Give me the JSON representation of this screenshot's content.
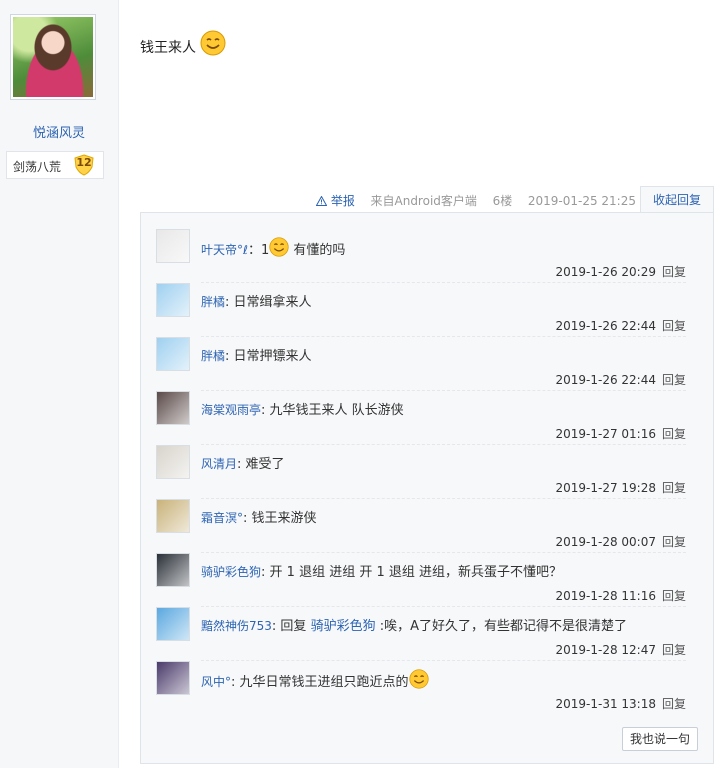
{
  "author": {
    "username": "悦涵风灵",
    "level_name": "剑荡八荒",
    "level_number": "12"
  },
  "post": {
    "content": "钱王来人",
    "report_label": "举报",
    "client": "来自Android客户端",
    "floor": "6楼",
    "time": "2019-01-25 21:25",
    "collapse_label": "收起回复"
  },
  "replies": [
    {
      "user": "叶天帝°ℓ",
      "sep": "：1",
      "text": "有懂的吗",
      "quoted": "",
      "time": "2019-1-26 20:29",
      "reply_label": "回复",
      "avatar_color": "#e8e8e8"
    },
    {
      "user": "胖橘",
      "sep": ": ",
      "text": "日常缉拿来人",
      "quoted": "",
      "time": "2019-1-26 22:44",
      "reply_label": "回复",
      "avatar_color": "#9fd0f0"
    },
    {
      "user": "胖橘",
      "sep": ": ",
      "text": "日常押镖来人",
      "quoted": "",
      "time": "2019-1-26 22:44",
      "reply_label": "回复",
      "avatar_color": "#9fd0f0"
    },
    {
      "user": "海棠观雨亭",
      "sep": ": ",
      "text": "九华钱王来人 队长游侠",
      "quoted": "",
      "time": "2019-1-27 01:16",
      "reply_label": "回复",
      "avatar_color": "#5a4a48"
    },
    {
      "user": "风清月",
      "sep": ": ",
      "text": "难受了",
      "quoted": "",
      "time": "2019-1-27 19:28",
      "reply_label": "回复",
      "avatar_color": "#d8d4cc"
    },
    {
      "user": "霜音溟°",
      "sep": ": ",
      "text": "钱王来游侠",
      "quoted": "",
      "time": "2019-1-28 00:07",
      "reply_label": "回复",
      "avatar_color": "#c9b27a"
    },
    {
      "user": "骑驴彩色狗",
      "sep": ": ",
      "text": "开 1 退组 进组 开 1 退组 进组，新兵蛋子不懂吧？",
      "quoted": "",
      "time": "2019-1-28 11:16",
      "reply_label": "回复",
      "avatar_color": "#2a3038"
    },
    {
      "user": "黯然神伤753",
      "sep": ": 回复 ",
      "text": ":唉，A了好久了，有些都记得不是很清楚了",
      "quoted": "骑驴彩色狗",
      "time": "2019-1-28 12:47",
      "reply_label": "回复",
      "avatar_color": "#5aa8e0"
    },
    {
      "user": "风中°",
      "sep": ": ",
      "text": "九华日常钱王进组只跑近点的",
      "quoted": "",
      "time": "2019-1-31 13:18",
      "reply_label": "回复",
      "avatar_color": "#4a3a6a"
    }
  ],
  "say_button": "我也说一句"
}
